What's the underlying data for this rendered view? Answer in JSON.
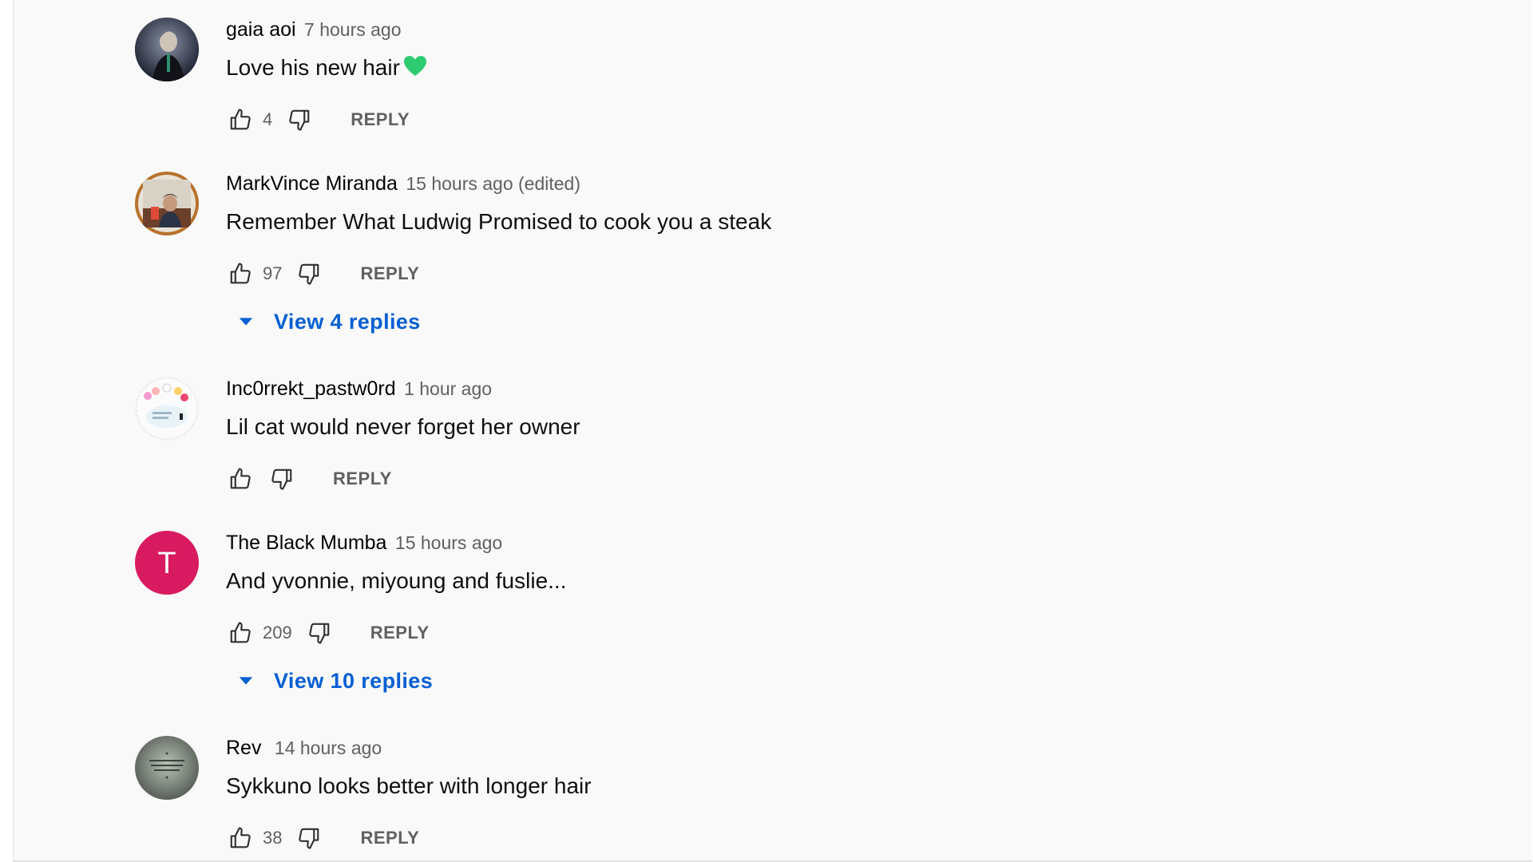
{
  "comments": [
    {
      "author": "gaia aoi",
      "time": "7 hours ago",
      "text": "Love his new hair",
      "likes": "4",
      "reply_label": "REPLY",
      "avatar_color": "#2d3142",
      "has_heart": true
    },
    {
      "author": "MarkVince Miranda",
      "time": "15 hours ago (edited)",
      "text": "Remember What Ludwig Promised to cook you a steak",
      "likes": "97",
      "reply_label": "REPLY",
      "avatar_color": "#8b5a3c",
      "view_replies": "View 4 replies"
    },
    {
      "author": "Inc0rrekt_pastw0rd",
      "time": "1 hour ago",
      "text": "Lil cat would never forget her owner",
      "likes": "",
      "reply_label": "REPLY",
      "avatar_color": "#f0f0f0"
    },
    {
      "author": "The Black Mumba",
      "time": "15 hours ago",
      "text": "And yvonnie, miyoung and fuslie...",
      "likes": "209",
      "reply_label": "REPLY",
      "avatar_color": "#d81b60",
      "avatar_letter": "T",
      "view_replies": "View 10 replies"
    },
    {
      "author": "Rev",
      "time": "14 hours ago",
      "text": "Sykkuno looks better with longer hair",
      "likes": "38",
      "reply_label": "REPLY",
      "avatar_color": "#7a7f7a"
    }
  ],
  "colors": {
    "link_blue": "#065fd4",
    "heart_green": "#2ecc71",
    "secondary_text": "#606060"
  },
  "icons": {
    "like": "thumbs-up-icon",
    "dislike": "thumbs-down-icon",
    "expand": "caret-down-icon",
    "heart": "green-heart-emoji"
  }
}
